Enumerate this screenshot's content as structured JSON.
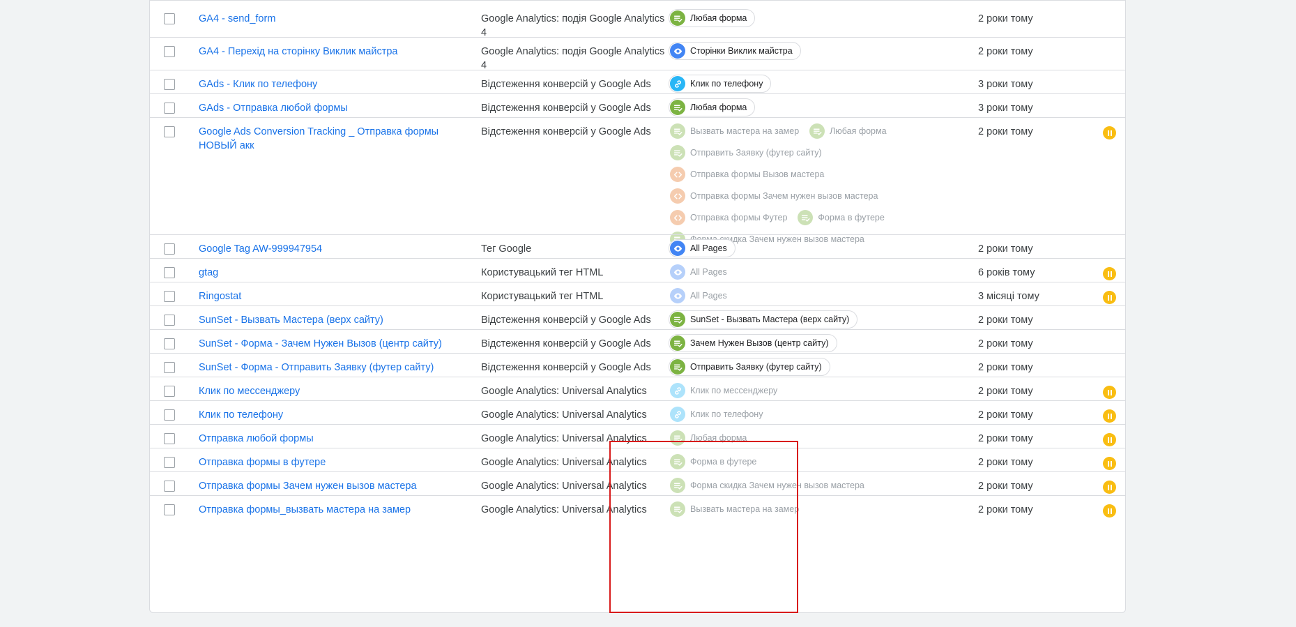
{
  "colors": {
    "link": "#1a73e8",
    "pause_badge": "#f9bd12",
    "highlight_border": "#d81b1b",
    "trigger_form": "#7cb342",
    "trigger_pageview": "#4285f4",
    "trigger_click": "#29b6f6",
    "trigger_custom": "#e67c30"
  },
  "rows": [
    {
      "name": "GA4 - send_form",
      "type": "Google Analytics: подія Google Analytics 4",
      "date": "2 роки тому",
      "paused": false,
      "triggers": [
        {
          "label": "Любая форма",
          "icon": "form-icon",
          "color": "green",
          "active": true
        }
      ]
    },
    {
      "name": "GA4 - Перехід на сторінку Виклик майстра",
      "type": "Google Analytics: подія Google Analytics 4",
      "date": "2 роки тому",
      "paused": false,
      "triggers": [
        {
          "label": "Сторінки Виклик майстра",
          "icon": "eye-icon",
          "color": "blue",
          "active": true
        }
      ]
    },
    {
      "name": "GAds - Клик по телефону",
      "type": "Відстеження конверсій у Google Ads",
      "date": "3 роки тому",
      "paused": false,
      "triggers": [
        {
          "label": "Клик по телефону",
          "icon": "link-icon",
          "color": "lightblue",
          "active": true
        }
      ]
    },
    {
      "name": "GAds - Отправка любой формы",
      "type": "Відстеження конверсій у Google Ads",
      "date": "3 роки тому",
      "paused": false,
      "triggers": [
        {
          "label": "Любая форма",
          "icon": "form-icon",
          "color": "green",
          "active": true
        }
      ]
    },
    {
      "name": "Google Ads Conversion Tracking _ Отправка формы НОВЫЙ акк",
      "type": "Відстеження конверсій у Google Ads",
      "date": "2 роки тому",
      "paused": true,
      "triggers": [
        {
          "label": "Вызвать мастера на замер",
          "icon": "form-icon",
          "color": "green",
          "active": false
        },
        {
          "label": "Любая форма",
          "icon": "form-icon",
          "color": "green",
          "active": false
        },
        {
          "label": "Отправить Заявку (футер сайту)",
          "icon": "form-icon",
          "color": "green",
          "active": false
        },
        {
          "label": "Отправка формы Вызов мастера",
          "icon": "code-icon",
          "color": "orange",
          "active": false
        },
        {
          "label": "Отправка формы Зачем нужен вызов мастера",
          "icon": "code-icon",
          "color": "orange",
          "active": false
        },
        {
          "label": "Отправка формы Футер",
          "icon": "code-icon",
          "color": "orange",
          "active": false
        },
        {
          "label": "Форма в футере",
          "icon": "form-icon",
          "color": "green",
          "active": false
        },
        {
          "label": "Форма скидка Зачем нужен вызов мастера",
          "icon": "form-icon",
          "color": "green",
          "active": false
        }
      ]
    },
    {
      "name": "Google Tag AW-999947954",
      "type": "Тег Google",
      "date": "2 роки тому",
      "paused": false,
      "triggers": [
        {
          "label": "All Pages",
          "icon": "eye-icon",
          "color": "blue",
          "active": true
        }
      ]
    },
    {
      "name": "gtag",
      "type": "Користувацький тег HTML",
      "date": "6 років тому",
      "paused": true,
      "triggers": [
        {
          "label": "All Pages",
          "icon": "eye-icon",
          "color": "blue",
          "active": false
        }
      ]
    },
    {
      "name": "Ringostat",
      "type": "Користувацький тег HTML",
      "date": "3 місяці тому",
      "paused": true,
      "triggers": [
        {
          "label": "All Pages",
          "icon": "eye-icon",
          "color": "blue",
          "active": false
        }
      ]
    },
    {
      "name": "SunSet - Вызвать Мастера (верх сайту)",
      "type": "Відстеження конверсій у Google Ads",
      "date": "2 роки тому",
      "paused": false,
      "triggers": [
        {
          "label": "SunSet - Вызвать Мастера (верх сайту)",
          "icon": "form-icon",
          "color": "green",
          "active": true
        }
      ]
    },
    {
      "name": "SunSet - Форма - Зачем Нужен Вызов (центр сайту)",
      "type": "Відстеження конверсій у Google Ads",
      "date": "2 роки тому",
      "paused": false,
      "triggers": [
        {
          "label": "Зачем Нужен Вызов (центр сайту)",
          "icon": "form-icon",
          "color": "green",
          "active": true
        }
      ]
    },
    {
      "name": "SunSet - Форма - Отправить Заявку (футер сайту)",
      "type": "Відстеження конверсій у Google Ads",
      "date": "2 роки тому",
      "paused": false,
      "triggers": [
        {
          "label": "Отправить Заявку (футер сайту)",
          "icon": "form-icon",
          "color": "green",
          "active": true
        }
      ]
    },
    {
      "name": "Клик по мессенджеру",
      "type": "Google Analytics: Universal Analytics",
      "date": "2 роки тому",
      "paused": true,
      "triggers": [
        {
          "label": "Клик по мессенджеру",
          "icon": "link-icon",
          "color": "lightblue",
          "active": false
        }
      ]
    },
    {
      "name": "Клик по телефону",
      "type": "Google Analytics: Universal Analytics",
      "date": "2 роки тому",
      "paused": true,
      "triggers": [
        {
          "label": "Клик по телефону",
          "icon": "link-icon",
          "color": "lightblue",
          "active": false
        }
      ]
    },
    {
      "name": "Отправка любой формы",
      "type": "Google Analytics: Universal Analytics",
      "date": "2 роки тому",
      "paused": true,
      "triggers": [
        {
          "label": "Любая форма",
          "icon": "form-icon",
          "color": "green",
          "active": false
        }
      ]
    },
    {
      "name": "Отправка формы в футере",
      "type": "Google Analytics: Universal Analytics",
      "date": "2 роки тому",
      "paused": true,
      "triggers": [
        {
          "label": "Форма в футере",
          "icon": "form-icon",
          "color": "green",
          "active": false
        }
      ]
    },
    {
      "name": "Отправка формы Зачем нужен вызов мастера",
      "type": "Google Analytics: Universal Analytics",
      "date": "2 роки тому",
      "paused": true,
      "triggers": [
        {
          "label": "Форма скидка Зачем нужен вызов мастера",
          "icon": "form-icon",
          "color": "green",
          "active": false
        }
      ]
    },
    {
      "name": "Отправка формы_вызвать мастера на замер",
      "type": "Google Analytics: Universal Analytics",
      "date": "2 роки тому",
      "paused": true,
      "triggers": [
        {
          "label": "Вызвать мастера на замер",
          "icon": "form-icon",
          "color": "green",
          "active": false
        }
      ]
    }
  ]
}
